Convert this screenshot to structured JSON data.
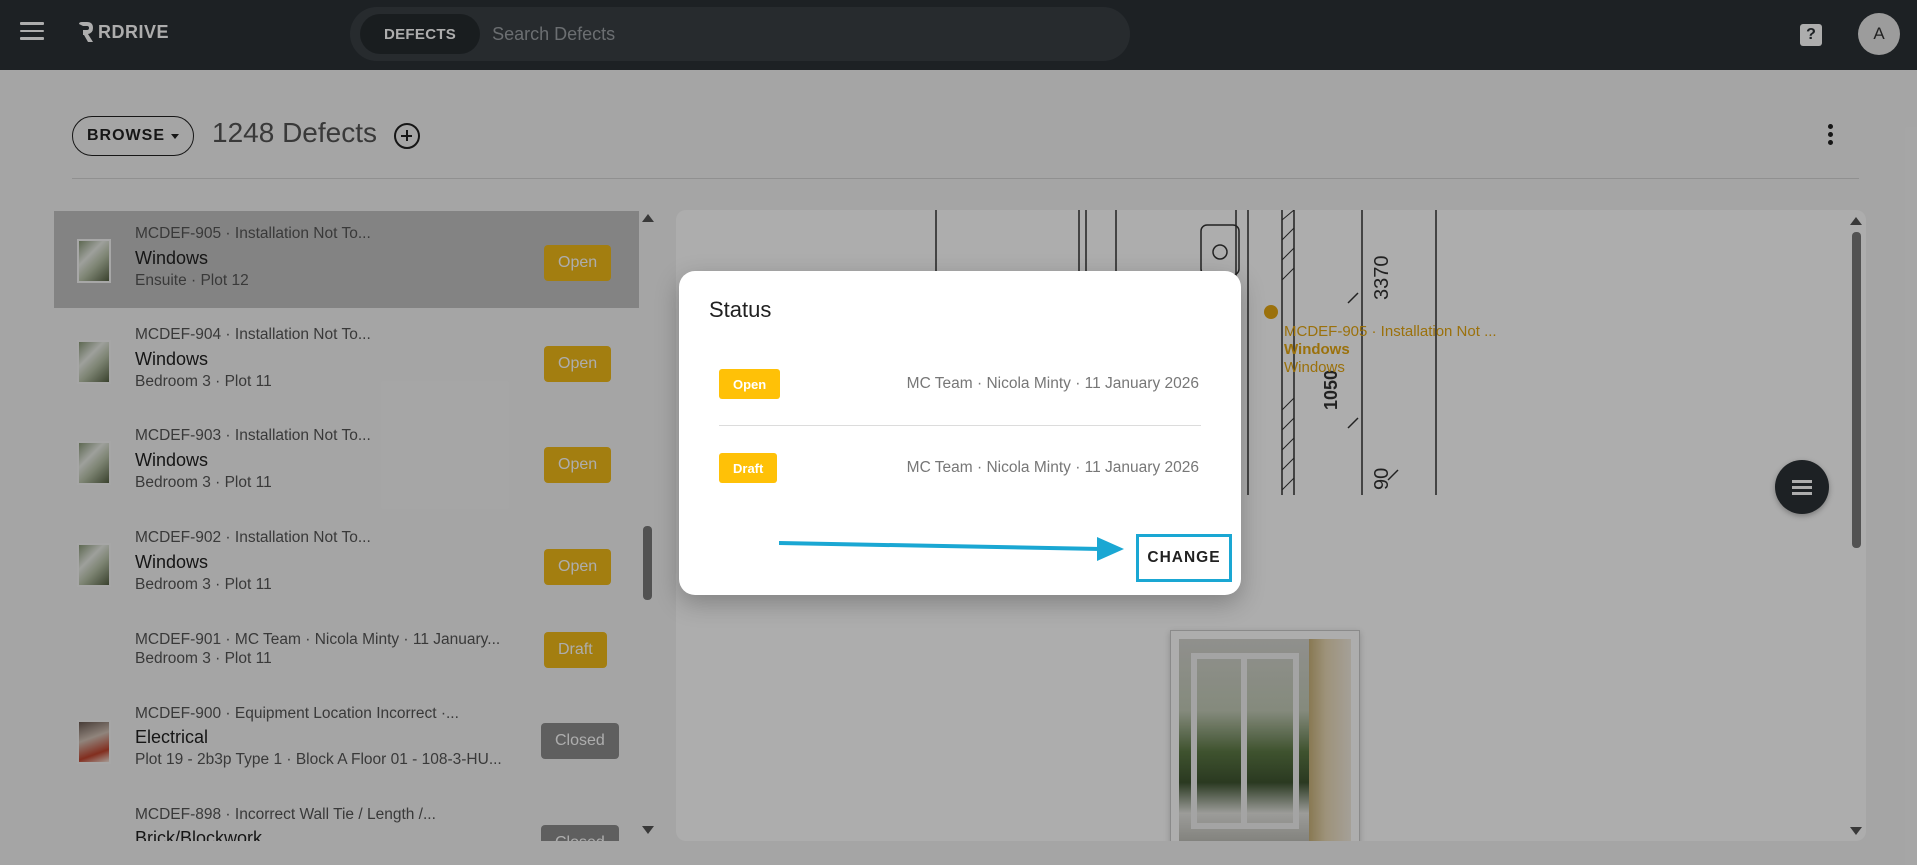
{
  "topbar": {
    "brand": "RDRIVE",
    "search_chip": "DEFECTS",
    "search_placeholder": "Search Defects",
    "help_icon": "?",
    "avatar_initial": "A"
  },
  "header": {
    "browse_label": "BROWSE",
    "count_text": "1248 Defects"
  },
  "list": {
    "items": [
      {
        "code": "MCDEF-905 · Installation Not To...",
        "title": "Windows",
        "sub": "Ensuite · Plot 12",
        "status": "Open",
        "selected": true,
        "thumb": "window-photo"
      },
      {
        "code": "MCDEF-904 · Installation Not To...",
        "title": "Windows",
        "sub": "Bedroom 3 · Plot 11",
        "status": "Open",
        "thumb": "window-photo"
      },
      {
        "code": "MCDEF-903 · Installation Not To...",
        "title": "Windows",
        "sub": "Bedroom 3 · Plot 11",
        "status": "Open",
        "thumb": "window-photo"
      },
      {
        "code": "MCDEF-902 · Installation Not To...",
        "title": "Windows",
        "sub": "Bedroom 3 · Plot 11",
        "status": "Open",
        "thumb": "window-photo"
      },
      {
        "code": "MCDEF-901 · MC Team · Nicola Minty · 11 January...",
        "title": "",
        "sub": "Bedroom 3 · Plot 11",
        "status": "Draft"
      },
      {
        "code": "MCDEF-900 · Equipment Location Incorrect ·...",
        "title": "Electrical",
        "sub": "Plot 19 - 2b3p Type 1 · Block A Floor 01 - 108-3-HU...",
        "status": "Closed",
        "thumb": "electrical-photo"
      },
      {
        "code": "MCDEF-898 · Incorrect Wall Tie / Length /...",
        "title": "Brick/Blockwork",
        "sub": "",
        "status": "Closed"
      }
    ]
  },
  "viewer": {
    "pin": {
      "code": "MCDEF-905 · Installation Not ...",
      "title": "Windows",
      "sub": "Windows"
    },
    "drawing_labels": [
      "3370",
      "1050",
      "90"
    ]
  },
  "dialog": {
    "title": "Status",
    "rows": [
      {
        "status": "Open",
        "meta": "MC Team · Nicola Minty · 11 January 2026"
      },
      {
        "status": "Draft",
        "meta": "MC Team · Nicola Minty · 11 January 2026"
      }
    ],
    "change_label": "CHANGE"
  },
  "colors": {
    "topbar": "#2b3135",
    "status_yellow": "#ffc107",
    "closed_grey": "#8d8d8d",
    "highlight_blue": "#1aa7d3"
  }
}
